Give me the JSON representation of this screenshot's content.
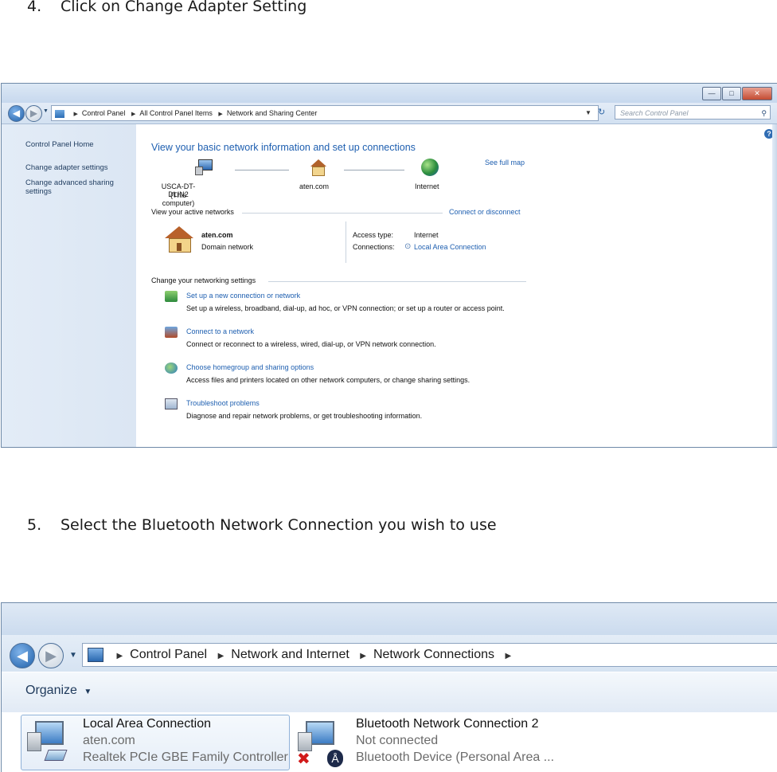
{
  "step4": {
    "number": "4.",
    "text": "Click on Change Adapter Setting"
  },
  "step5": {
    "number": "5.",
    "text": "Select the Bluetooth Network Connection you wish to use"
  },
  "window1": {
    "breadcrumb": [
      "Control Panel",
      "All Control Panel Items",
      "Network and Sharing Center"
    ],
    "search_placeholder": "Search Control Panel",
    "sidebar": {
      "home": "Control Panel Home",
      "items": [
        "Change adapter settings",
        "Change advanced sharing",
        "settings"
      ]
    },
    "heading": "View your basic network information and set up connections",
    "see_full_map": "See full map",
    "map": {
      "computer_name": "USCA-DT-DLIN2",
      "computer_sub": "(This computer)",
      "domain": "aten.com",
      "internet": "Internet"
    },
    "active_networks_label": "View your active networks",
    "connect_disconnect": "Connect or disconnect",
    "active": {
      "name": "aten.com",
      "type": "Domain network",
      "access_type_label": "Access type:",
      "access_type_value": "Internet",
      "connections_label": "Connections:",
      "connections_value": "Local Area Connection"
    },
    "change_settings_label": "Change your networking settings",
    "tasks": [
      {
        "title": "Set up a new connection or network",
        "desc": "Set up a wireless, broadband, dial-up, ad hoc, or VPN connection; or set up a router or access point."
      },
      {
        "title": "Connect to a network",
        "desc": "Connect or reconnect to a wireless, wired, dial-up, or VPN network connection."
      },
      {
        "title": "Choose homegroup and sharing options",
        "desc": "Access files and printers located on other network computers, or change sharing settings."
      },
      {
        "title": "Troubleshoot problems",
        "desc": "Diagnose and repair network problems, or get troubleshooting information."
      }
    ]
  },
  "window2": {
    "breadcrumb": [
      "Control Panel",
      "Network and Internet",
      "Network Connections"
    ],
    "organize": "Organize",
    "connections": [
      {
        "name": "Local Area Connection",
        "status": "aten.com",
        "device": "Realtek PCIe GBE Family Controller"
      },
      {
        "name": "Bluetooth Network Connection 2",
        "status": "Not connected",
        "device": "Bluetooth Device (Personal Area ..."
      }
    ]
  }
}
